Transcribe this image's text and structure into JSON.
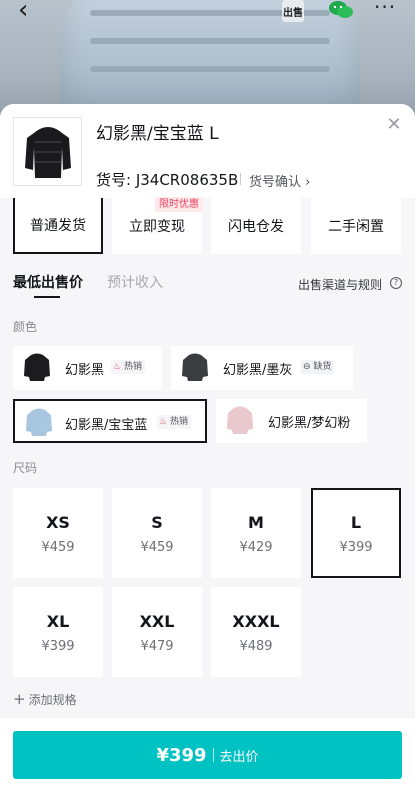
{
  "background": {
    "tag_text": "出售"
  },
  "product": {
    "title": "幻影黑/宝宝蓝 L",
    "sku": "货号: J34CR08635B",
    "sku_confirm": "货号确认 ›"
  },
  "channels": {
    "badge": "限时优惠",
    "items": [
      {
        "label": "普通发货",
        "selected": true
      },
      {
        "label": "立即变现",
        "selected": false
      },
      {
        "label": "闪电仓发",
        "selected": false
      },
      {
        "label": "二手闲置",
        "selected": false
      }
    ]
  },
  "tabs": {
    "active": "最低出售价",
    "inactive": "预计收入",
    "rules": "出售渠道与规则"
  },
  "colors": {
    "label": "颜色",
    "items": [
      {
        "name": "幻影黑",
        "badge": "热销",
        "badge_type": "hot",
        "swatch": "#1c1c1f",
        "selected": false
      },
      {
        "name": "幻影黑/墨灰",
        "badge": "缺货",
        "badge_type": "oos",
        "swatch": "#3a3c40",
        "selected": false
      },
      {
        "name": "幻影黑/宝宝蓝",
        "badge": "热销",
        "badge_type": "hot",
        "swatch": "#a9c6e0",
        "selected": true
      },
      {
        "name": "幻影黑/梦幻粉",
        "badge": "",
        "badge_type": "",
        "swatch": "#e9c9ce",
        "selected": false
      }
    ]
  },
  "sizes": {
    "label": "尺码",
    "items": [
      {
        "size": "XS",
        "price": "¥459",
        "selected": false
      },
      {
        "size": "S",
        "price": "¥459",
        "selected": false
      },
      {
        "size": "M",
        "price": "¥429",
        "selected": false
      },
      {
        "size": "L",
        "price": "¥399",
        "selected": true
      },
      {
        "size": "XL",
        "price": "¥399",
        "selected": false
      },
      {
        "size": "XXL",
        "price": "¥479",
        "selected": false
      },
      {
        "size": "XXXL",
        "price": "¥489",
        "selected": false
      }
    ],
    "add_spec": "添加规格"
  },
  "cta": {
    "price": "¥399",
    "label": "去出价",
    "color": "#01c2c3"
  }
}
